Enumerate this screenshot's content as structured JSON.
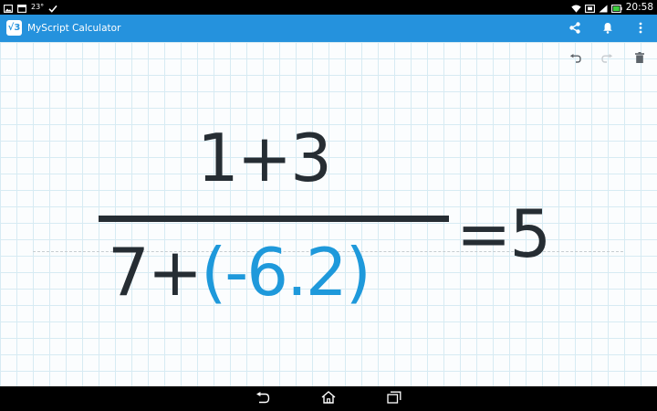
{
  "status_bar": {
    "temperature": "23°",
    "time": "20:58",
    "icons": [
      "photo-icon",
      "calendar-icon",
      "check-icon",
      "wifi-icon",
      "screen-cast-icon",
      "signal-icon",
      "battery-icon"
    ]
  },
  "app_bar": {
    "logo_text": "√3",
    "title": "MyScript Calculator",
    "actions": [
      "share-icon",
      "notification-bell-icon",
      "more-vert-icon"
    ]
  },
  "toolbar": {
    "actions": [
      "undo-icon",
      "redo-icon",
      "trash-icon"
    ]
  },
  "expression": {
    "numerator": "1+3",
    "denominator_prefix": "7+",
    "denominator_group": "(-6.2)",
    "result": "=5"
  },
  "colors": {
    "app_bar": "#2592dd",
    "ink": "#262d33",
    "highlight": "#1e99db",
    "grid": "#d7ebf3"
  },
  "nav_bar": {
    "actions": [
      "back-icon",
      "home-icon",
      "recent-apps-icon"
    ]
  }
}
